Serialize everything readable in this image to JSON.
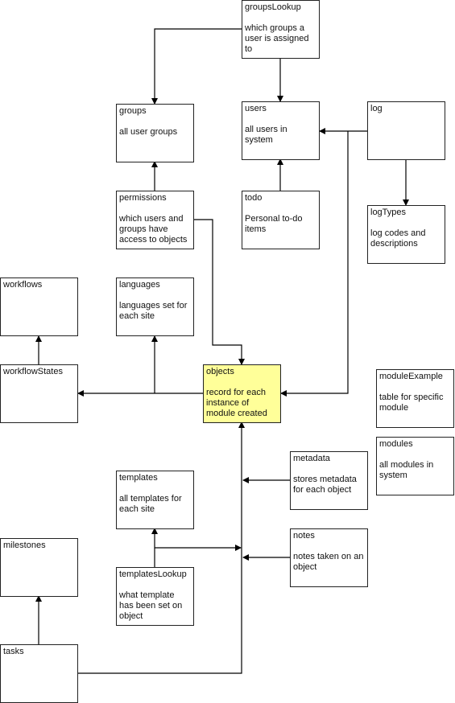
{
  "highlight_color": "#ffff99",
  "tables": {
    "groupsLookup": {
      "name": "groupsLookup",
      "desc": "which groups a user is assigned to"
    },
    "groups": {
      "name": "groups",
      "desc": "all user groups"
    },
    "users": {
      "name": "users",
      "desc": "all users in system"
    },
    "log": {
      "name": "log",
      "desc": ""
    },
    "permissions": {
      "name": "permissions",
      "desc": "which users and groups have access to objects"
    },
    "todo": {
      "name": "todo",
      "desc": "Personal to-do items"
    },
    "logTypes": {
      "name": "logTypes",
      "desc": "log codes and descriptions"
    },
    "workflows": {
      "name": "workflows",
      "desc": ""
    },
    "languages": {
      "name": "languages",
      "desc": "languages set for each site"
    },
    "workflowStates": {
      "name": "workflowStates",
      "desc": ""
    },
    "objects": {
      "name": "objects",
      "desc": "record for each instance of module created"
    },
    "moduleExample": {
      "name": "moduleExample",
      "desc": "table for specific module"
    },
    "modules": {
      "name": "modules",
      "desc": "all modules in system"
    },
    "metadata": {
      "name": "metadata",
      "desc": "stores metadata for each object"
    },
    "templates": {
      "name": "templates",
      "desc": "all templates for each site"
    },
    "notes": {
      "name": "notes",
      "desc": "notes taken on an object"
    },
    "milestones": {
      "name": "milestones",
      "desc": ""
    },
    "templatesLookup": {
      "name": "templatesLookup",
      "desc": "what template has been set on object"
    },
    "tasks": {
      "name": "tasks",
      "desc": ""
    }
  },
  "relations": [
    {
      "from": "groupsLookup",
      "to": "groups"
    },
    {
      "from": "groupsLookup",
      "to": "users"
    },
    {
      "from": "log",
      "to": "users"
    },
    {
      "from": "log",
      "to": "objects"
    },
    {
      "from": "log",
      "to": "logTypes"
    },
    {
      "from": "permissions",
      "to": "groups"
    },
    {
      "from": "permissions",
      "to": "objects"
    },
    {
      "from": "todo",
      "to": "users"
    },
    {
      "from": "workflowStates",
      "to": "workflows"
    },
    {
      "from": "objects",
      "to": "workflowStates"
    },
    {
      "from": "objects",
      "to": "languages"
    },
    {
      "from": "metadata",
      "to": "objects"
    },
    {
      "from": "notes",
      "to": "objects"
    },
    {
      "from": "templatesLookup",
      "to": "templates"
    },
    {
      "from": "templatesLookup",
      "to": "objects"
    },
    {
      "from": "tasks",
      "to": "milestones"
    },
    {
      "from": "tasks",
      "to": "objects"
    }
  ]
}
